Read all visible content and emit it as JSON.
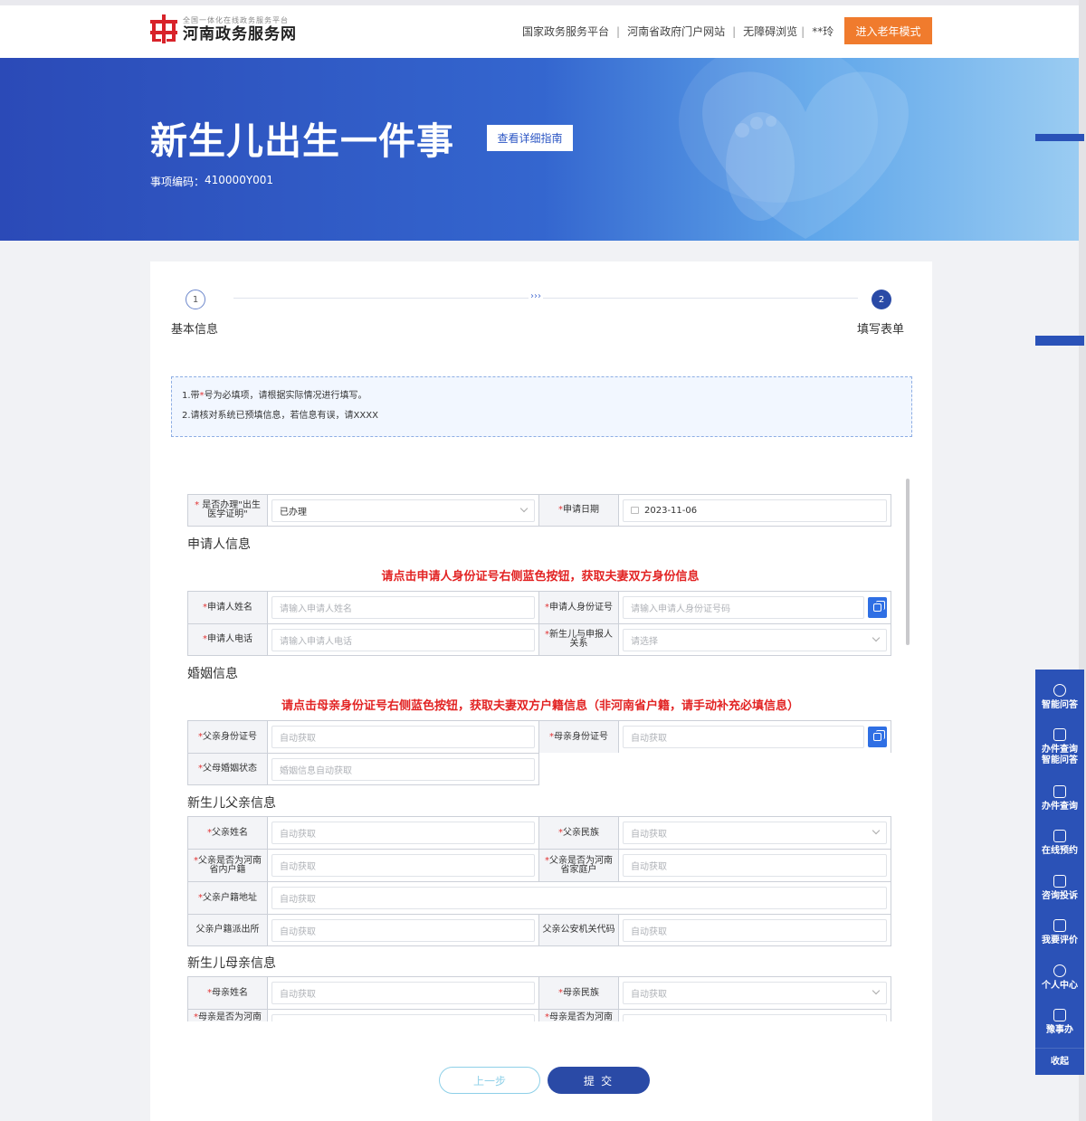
{
  "header": {
    "logo_sub": "全国一体化在线政务服务平台",
    "logo_main": "河南政务服务网",
    "links": [
      "国家政务服务平台",
      "河南省政府门户网站",
      "无障碍浏览"
    ],
    "user": "**玲",
    "elder_mode": "进入老年模式"
  },
  "banner": {
    "title": "新生儿出生一件事",
    "guide_button": "查看详细指南",
    "code_label": "事项编码：",
    "code_value": "410000Y001"
  },
  "steps": [
    {
      "num": "1",
      "label": "基本信息"
    },
    {
      "num": "2",
      "label": "填写表单"
    }
  ],
  "step_arrow": "›››",
  "notice": {
    "line1_pre": "1.带",
    "line1_star": "*",
    "line1_post": "号为必填项，请根据实际情况进行填写。",
    "line2": "2.请核对系统已预填信息，若信息有误，请XXXX"
  },
  "form": {
    "top_row": {
      "label1": "是否办理\"出生医学证明\"",
      "value1": "已办理",
      "label2": "申请日期",
      "value2": "2023-11-06"
    },
    "applicant_section": "申请人信息",
    "applicant_hint": "请点击申请人身份证号右侧蓝色按钮，获取夫妻双方身份信息",
    "applicant_name_label": "申请人姓名",
    "applicant_name_ph": "请输入申请人姓名",
    "applicant_id_label": "申请人身份证号",
    "applicant_id_ph": "请输入申请人身份证号码",
    "applicant_phone_label": "申请人电话",
    "applicant_phone_ph": "请输入申请人电话",
    "relation_label": "新生儿与申报人关系",
    "relation_ph": "请选择",
    "marriage_section": "婚姻信息",
    "marriage_hint": "请点击母亲身份证号右侧蓝色按钮，获取夫妻双方户籍信息（非河南省户籍，请手动补充必填信息）",
    "father_id_label": "父亲身份证号",
    "mother_id_label": "母亲身份证号",
    "marriage_status_label": "父母婚姻状态",
    "marriage_status_ph": "婚姻信息自动获取",
    "auto": "自动获取",
    "father_section": "新生儿父亲信息",
    "father_name_label": "父亲姓名",
    "father_nation_label": "父亲民族",
    "father_henan_label": "父亲是否为河南省内户籍",
    "father_household_label": "父亲是否为河南省家庭户",
    "father_address_label": "父亲户籍地址",
    "father_police_label": "父亲户籍派出所",
    "father_police_code_label": "父亲公安机关代码",
    "mother_section": "新生儿母亲信息",
    "mother_name_label": "母亲姓名",
    "mother_nation_label": "母亲民族",
    "mother_henan_label": "母亲是否为河南",
    "mother_household_label": "母亲是否为河南"
  },
  "buttons": {
    "prev": "上一步",
    "submit": "提 交"
  },
  "sidebar": [
    {
      "label": "智能问答",
      "icon": "robot-icon"
    },
    {
      "label": "办件查询\n智能问答",
      "icon": "search-doc-icon"
    },
    {
      "label": "办件查询",
      "icon": "search-doc-icon"
    },
    {
      "label": "在线预约",
      "icon": "calendar-icon"
    },
    {
      "label": "咨询投诉",
      "icon": "chat-icon"
    },
    {
      "label": "我要评价",
      "icon": "edit-icon"
    },
    {
      "label": "个人中心",
      "icon": "user-icon"
    },
    {
      "label": "豫事办",
      "icon": "app-icon"
    },
    {
      "label": "收起",
      "icon": ""
    }
  ],
  "colors": {
    "brand_blue": "#2a4aa6",
    "accent_orange": "#f07b2d",
    "required_red": "#e23333",
    "id_button_blue": "#2f6fe4"
  }
}
